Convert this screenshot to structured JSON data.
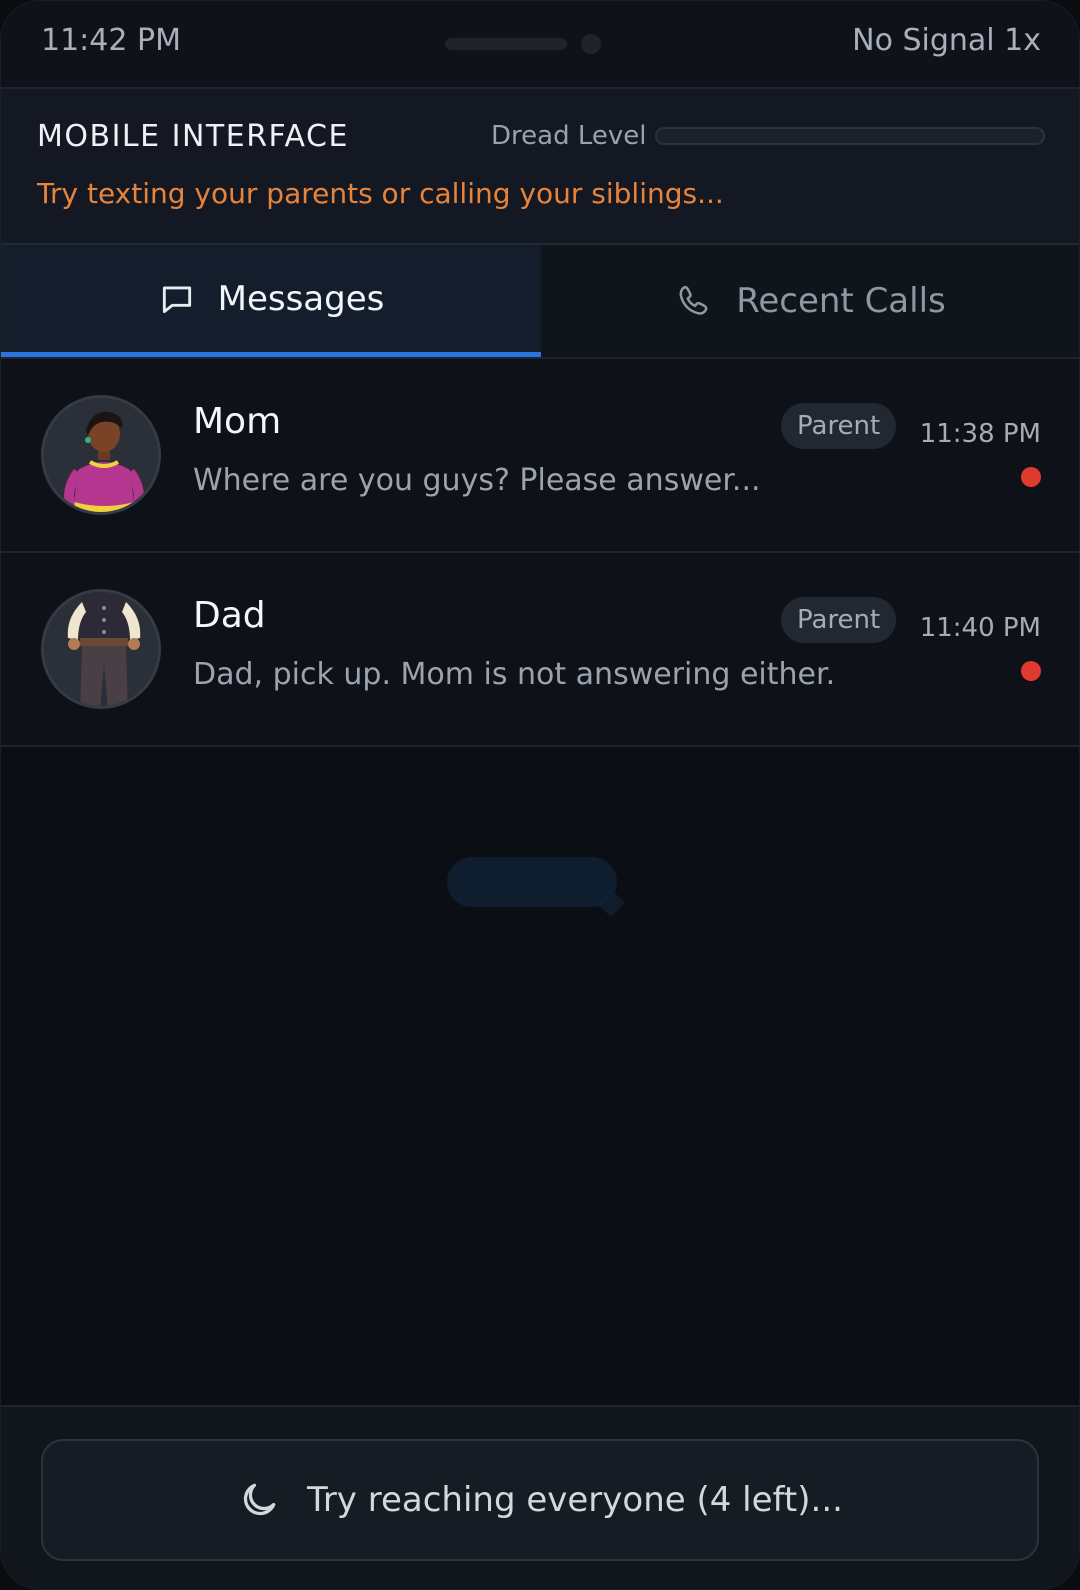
{
  "status_bar": {
    "time": "11:42 PM",
    "signal": "No Signal 1x"
  },
  "header": {
    "title": "MOBILE INTERFACE",
    "dread_label": "Dread Level",
    "dread_level": 0,
    "hint": "Try texting your parents or calling your siblings..."
  },
  "tabs": [
    {
      "label": "Messages",
      "icon": "message-icon",
      "active": true
    },
    {
      "label": "Recent Calls",
      "icon": "phone-icon",
      "active": false
    }
  ],
  "conversations": [
    {
      "name": "Mom",
      "role": "Parent",
      "time": "11:38 PM",
      "preview": "Where are you guys? Please answer...",
      "unread": true
    },
    {
      "name": "Dad",
      "role": "Parent",
      "time": "11:40 PM",
      "preview": "Dad, pick up. Mom is not answering either.",
      "unread": true
    }
  ],
  "footer": {
    "button_label": "Try reaching everyone (4 left)...",
    "button_icon": "moon-icon"
  },
  "colors": {
    "accent": "#2b73e0",
    "hint": "#e8843a",
    "unread": "#e0392f",
    "background": "#0c0f14"
  }
}
